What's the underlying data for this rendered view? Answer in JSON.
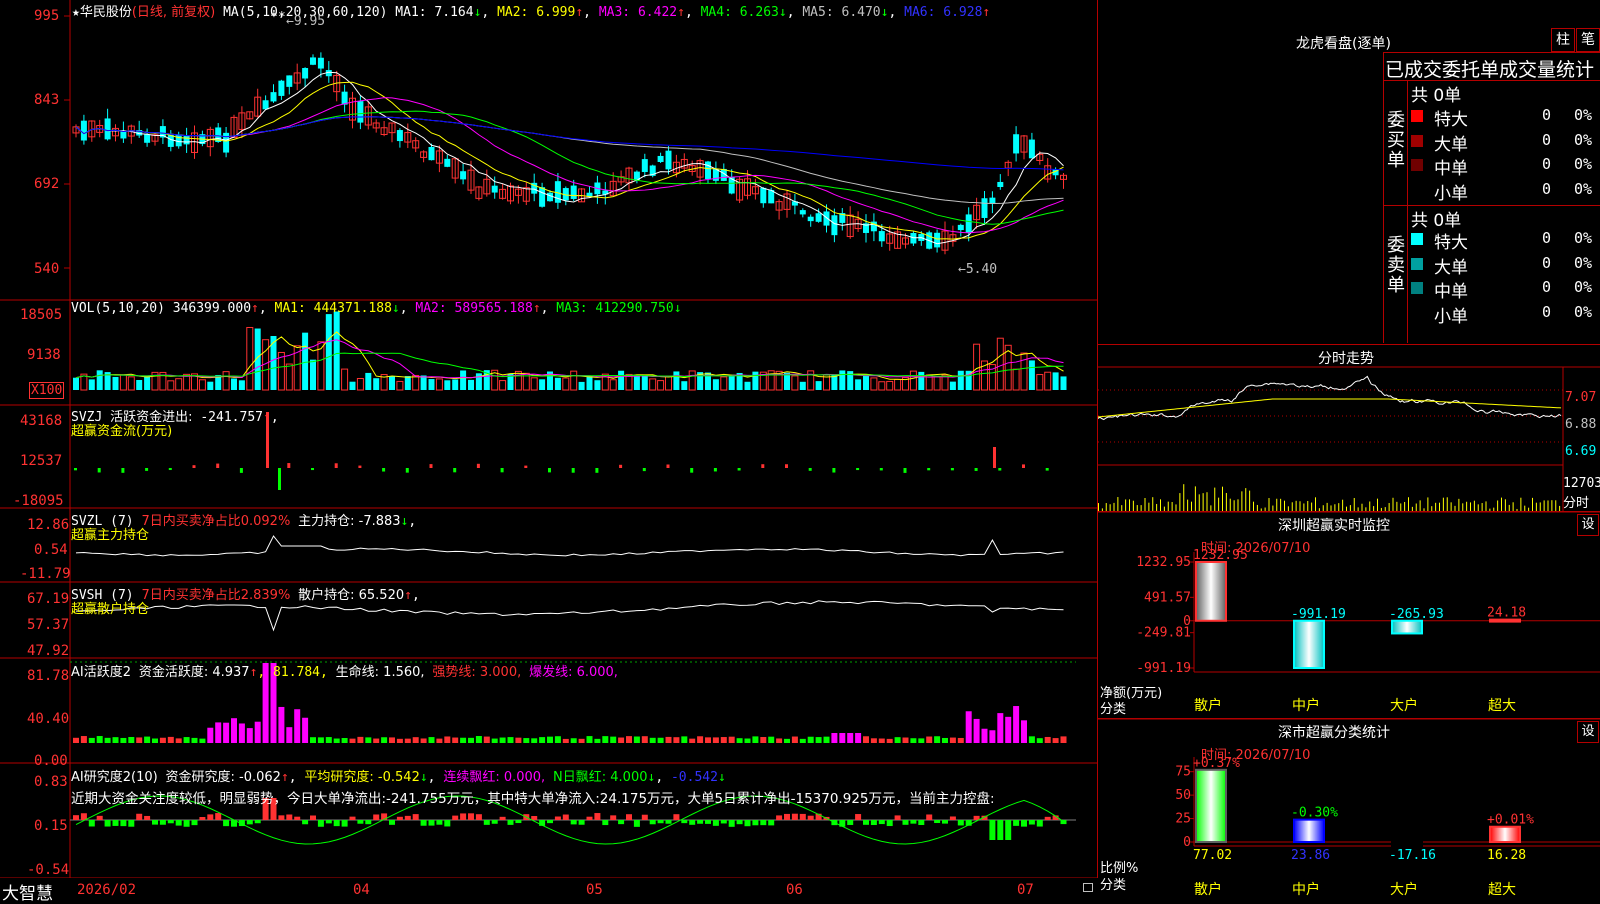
{
  "colors": {
    "up": "#ff3232",
    "down": "#00ffff",
    "grid": "#b40000",
    "bg": "#000000",
    "ma1": "#ffffff",
    "ma2": "#ffff00",
    "ma3": "#ff00ff",
    "ma4": "#00ff00",
    "ma5": "#c0c0c0",
    "ma6": "#0000ff"
  },
  "main_chart": {
    "star": "★",
    "stock_name": "华民股份",
    "period": "(日线, 前复权)",
    "ma_spec": "MA(5,10,20,30,60,120)",
    "ma_values": [
      {
        "label": "MA1: 7.164",
        "arrow": "↓"
      },
      {
        "label": "MA2: 6.999",
        "arrow": "↑"
      },
      {
        "label": "MA3: 6.422",
        "arrow": "↑"
      },
      {
        "label": "MA4: 6.263",
        "arrow": "↓"
      },
      {
        "label": "MA5: 6.470",
        "arrow": "↓"
      },
      {
        "label": "MA6: 6.928",
        "arrow": "↑"
      }
    ],
    "y_ticks": [
      "995",
      "843",
      "692",
      "540"
    ],
    "high_label": "←9.95",
    "low_label": "←5.40",
    "marks": "**"
  },
  "vol_panel": {
    "header": "VOL(5,10,20)",
    "value": "346399.000",
    "arrow": "↑",
    "ma1": "MA1: 444371.188",
    "ma1_arrow": "↓",
    "ma2": "MA2: 589565.188",
    "ma2_arrow": "↑",
    "ma3": "MA3: 412290.750",
    "ma3_arrow": "↓",
    "y_ticks": [
      "18505",
      "9138"
    ],
    "unit": "X100"
  },
  "svzj_panel": {
    "header": "SVZJ",
    "desc": "活跃资金进出:",
    "value": "-241.757",
    "arrow": "↑",
    ",": ",",
    "subtitle": "超赢资金流(万元)",
    "y_ticks": [
      "43168",
      "12537",
      "-18095"
    ]
  },
  "svzl_panel": {
    "header": "SVZL (7)",
    "ratio": "7日内买卖净占比0.092%",
    "main": "主力持仓: -7.883",
    "arrow": "↓",
    "comma": ",",
    "subtitle": "超赢主力持仓",
    "y_ticks": [
      "12.86",
      "0.54",
      "-11.79"
    ]
  },
  "svsh_panel": {
    "header": "SVSH (7)",
    "ratio": "7日内买卖净占比2.839%",
    "retail": "散户持仓: 65.520",
    "arrow": "↑",
    "comma": ",",
    "subtitle": "超赢散户持仓",
    "y_ticks": [
      "67.19",
      "57.37",
      "47.92"
    ]
  },
  "ai_active_panel": {
    "header": "AI活跃度2",
    "a": "资金活跃度: 4.937",
    "a_arrow": "↑",
    "b": ", 81.784,",
    "c": "生命线: 1.560,",
    "d": "强势线: 3.000,",
    "e": "爆发线: 6.000,",
    "y_ticks": [
      "81.78",
      "40.40",
      "0.00"
    ]
  },
  "ai_research_panel": {
    "header": "AI研究度2(10)",
    "a": "资金研究度: -0.062",
    "a_arrow": "↑",
    ",": ",",
    "b": "平均研究度: -0.542",
    "b_arrow": "↓",
    "c": "连续飘红: 0.000,",
    "d": "N日飘红: 4.000",
    "d_arrow": "↓",
    "e": "-0.542",
    "e_arrow": "↓",
    "text": "近期大资金关注度较低，明显弱势，今日大单净流出:-241.755万元，其中特大单净流入:24.175万元，大单5日累计净出-15370.925万元，当前主力控盘:",
    "y_ticks": [
      "0.83",
      "0.15",
      "-0.54"
    ]
  },
  "x_axis": {
    "labels": [
      "2026/02",
      "04",
      "05",
      "06",
      "07"
    ],
    "brand": "大智慧"
  },
  "dragon_panel": {
    "title": "龙虎看盘(逐单)",
    "btn_bar": "柱",
    "btn_pen": "笔",
    "header": "已成交委托单成交量统计",
    "buy_side": "委买单",
    "sell_side": "委卖单",
    "buy_total": "共 0单",
    "sell_total": "共 0单",
    "buy_rows": [
      {
        "label": "特大",
        "count": "0",
        "pct": "0%",
        "color": "#ff0000"
      },
      {
        "label": "大单",
        "count": "0",
        "pct": "0%",
        "color": "#a00000"
      },
      {
        "label": "中单",
        "count": "0",
        "pct": "0%",
        "color": "#700000"
      },
      {
        "label": "小单",
        "count": "0",
        "pct": "0%",
        "color": ""
      }
    ],
    "sell_rows": [
      {
        "label": "特大",
        "count": "0",
        "pct": "0%",
        "color": "#00ffff"
      },
      {
        "label": "大单",
        "count": "0",
        "pct": "0%",
        "color": "#00a0a0"
      },
      {
        "label": "中单",
        "count": "0",
        "pct": "0%",
        "color": "#008080"
      },
      {
        "label": "小单",
        "count": "0",
        "pct": "0%",
        "color": ""
      }
    ]
  },
  "intraday_panel": {
    "title": "分时走势",
    "y_ticks": [
      "7.07",
      "6.88",
      "6.69"
    ],
    "vol_label": "12703",
    "unit": "分时"
  },
  "sz_monitor": {
    "title": "深圳超赢实时监控",
    "btn": "设",
    "time": "时间: 2026/07/10",
    "y_ticks": [
      "1232.95",
      "491.57",
      "0",
      "-249.81",
      "-991.19"
    ],
    "ylabel": "净额(万元)",
    "xlabel": "分类",
    "chart_data": {
      "type": "bar",
      "categories": [
        "散户",
        "中户",
        "大户",
        "超大"
      ],
      "values": [
        1232.95,
        -991.19,
        -265.93,
        24.18
      ],
      "value_labels": [
        "1232.95",
        "-991.19",
        "-265.93",
        "24.18"
      ],
      "ylim": [
        -991.19,
        1232.95
      ]
    }
  },
  "sz_class": {
    "title": "深市超赢分类统计",
    "btn": "设",
    "time": "时间: 2026/07/10",
    "y_ticks": [
      "75",
      "50",
      "25",
      "0"
    ],
    "ylabel": "比例%",
    "xlabel": "分类",
    "chart_data": {
      "type": "bar",
      "categories": [
        "散户",
        "中户",
        "大户",
        "超大"
      ],
      "values": [
        77.02,
        23.86,
        -17.16,
        16.28
      ],
      "value_labels": [
        "77.02",
        "23.86",
        "-17.16",
        "16.28"
      ],
      "change_labels": [
        "+0.37%",
        "-0.30%",
        "",
        "+0.01%"
      ],
      "ylim": [
        0,
        80
      ]
    }
  }
}
